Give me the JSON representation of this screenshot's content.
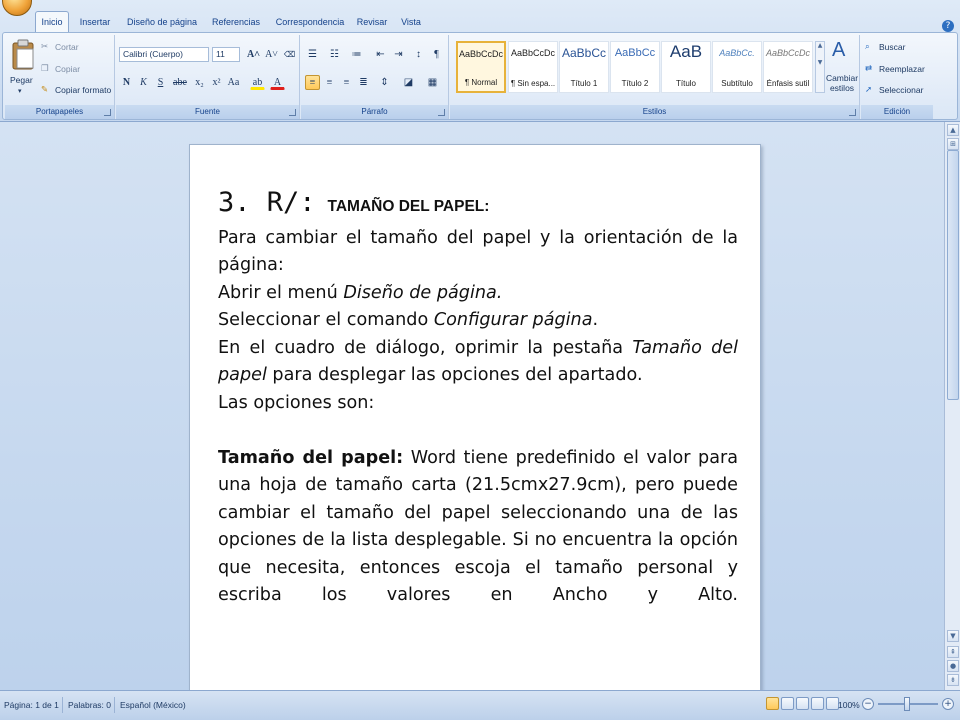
{
  "ribbon": {
    "tabs": [
      "Inicio",
      "Insertar",
      "Diseño de página",
      "Referencias",
      "Correspondencia",
      "Revisar",
      "Vista"
    ],
    "active_tab": "Inicio",
    "clipboard": {
      "paste_label": "Pegar",
      "cut_label": "Cortar",
      "copy_label": "Copiar",
      "format_painter_label": "Copiar formato",
      "group_label": "Portapapeles"
    },
    "font": {
      "font_name": "Calibri (Cuerpo)",
      "font_size": "11",
      "bold": "N",
      "italic": "K",
      "underline": "S",
      "group_label": "Fuente"
    },
    "paragraph": {
      "group_label": "Párrafo"
    },
    "styles": {
      "items": [
        {
          "sample": "AaBbCcDc",
          "name": "¶ Normal"
        },
        {
          "sample": "AaBbCcDc",
          "name": "¶ Sin espa..."
        },
        {
          "sample": "AaBbCc",
          "name": "Título 1"
        },
        {
          "sample": "AaBbCc",
          "name": "Título 2"
        },
        {
          "sample": "AaB",
          "name": "Título"
        },
        {
          "sample": "AaBbCc.",
          "name": "Subtítulo"
        },
        {
          "sample": "AaBbCcDc",
          "name": "Énfasis sutil"
        }
      ],
      "change_styles_label": "Cambiar estilos",
      "group_label": "Estilos"
    },
    "editing": {
      "find_label": "Buscar",
      "replace_label": "Reemplazar",
      "select_label": "Seleccionar",
      "group_label": "Edición"
    }
  },
  "document": {
    "heading_number": "3. R/:",
    "heading_title": "TAMAÑO DEL PAPEL:",
    "para1": "Para cambiar el tamaño del papel y la orientación de la página:",
    "line2_prefix": "Abrir el menú ",
    "line2_italic": "Diseño de página.",
    "line3_prefix": "Seleccionar el comando ",
    "line3_italic": "Configurar página",
    "line3_suffix": ".",
    "para4_prefix": "En el cuadro de diálogo, oprimir la pestaña ",
    "para4_italic": "Tamaño del papel",
    "para4_suffix": " para desplegar las opciones del apartado.",
    "line5": "Las opciones son:",
    "para6_bold": "Tamaño del papel:",
    "para6_text": " Word tiene predefinido el valor para una hoja de tamaño carta (21.5cmx27.9cm), pero puede cambiar el tamaño del papel seleccionando una de las opciones de la lista desplegable. Si no encuentra la opción que necesita, entonces escoja el tamaño personal y escriba los valores en Ancho y Alto."
  },
  "statusbar": {
    "page": "Página: 1 de 1",
    "words": "Palabras: 0",
    "language": "Español (México)",
    "zoom": "100%"
  },
  "colors": {
    "ribbon_bg": "#c6d8ef",
    "tab_text": "#15428b",
    "selected_style": "#e7b23a",
    "doc_bg": "#bdd2ec"
  }
}
